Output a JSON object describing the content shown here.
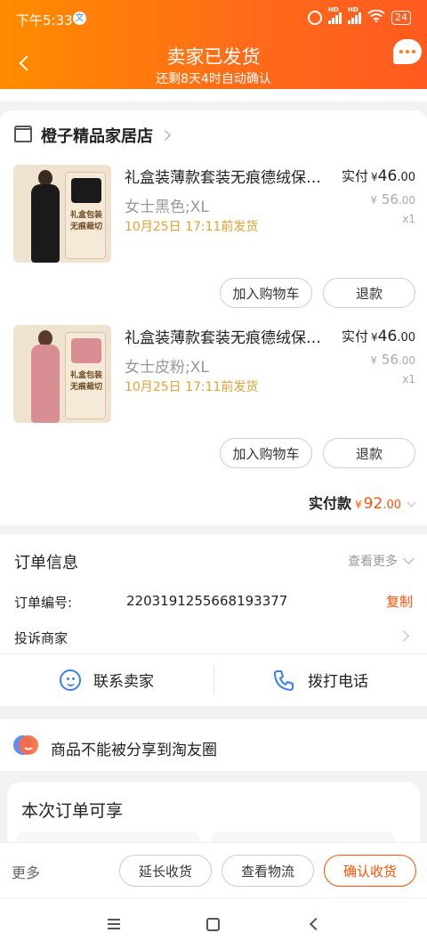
{
  "status_bar": {
    "time": "下午5:33",
    "app_icon": "文",
    "battery": "24",
    "signal1_label": "HD",
    "signal2_label": "HD"
  },
  "header": {
    "title": "卖家已发货",
    "subtitle": "还剩8天4时自动确认",
    "color_start": "#ff8c00",
    "color_end": "#ff5a1f"
  },
  "shop": {
    "name": "橙子精品家居店"
  },
  "items": [
    {
      "title": "礼盒装薄款套装无痕德绒保…",
      "spec": "女士黑色;XL",
      "ship": "10月25日 17:11前发货",
      "paid_label": "实付",
      "paid_currency": "¥",
      "paid_int": "46",
      "paid_dec": ".00",
      "orig_currency": "¥",
      "orig_int": "56",
      "orig_dec": ".00",
      "qty": "x1",
      "btn_add": "加入购物车",
      "btn_refund": "退款",
      "thumb_box_text": "礼盒包装\n无痕裁切",
      "garment_color": "#1a1a1a"
    },
    {
      "title": "礼盒装薄款套装无痕德绒保…",
      "spec": "女士皮粉;XL",
      "ship": "10月25日 17:11前发货",
      "paid_label": "实付",
      "paid_currency": "¥",
      "paid_int": "46",
      "paid_dec": ".00",
      "orig_currency": "¥",
      "orig_int": "56",
      "orig_dec": ".00",
      "qty": "x1",
      "btn_add": "加入购物车",
      "btn_refund": "退款",
      "thumb_box_text": "礼盒包装\n无痕裁切",
      "garment_color": "#d98e94"
    }
  ],
  "total": {
    "label": "实付款",
    "currency": "¥",
    "int": "92",
    "dec": ".00"
  },
  "order_info": {
    "title": "订单信息",
    "more": "查看更多",
    "order_no_label": "订单编号:",
    "order_no": "2203191255668193377",
    "copy": "复制",
    "complain": "投诉商家",
    "contact_seller": "联系卖家",
    "call": "拨打电话"
  },
  "share": {
    "text": "商品不能被分享到淘友圈"
  },
  "enjoy": {
    "title": "本次订单可享"
  },
  "bottom_bar": {
    "more": "更多",
    "extend": "延长收货",
    "logistics": "查看物流",
    "confirm": "确认收货"
  },
  "colors": {
    "accent": "#ff5000",
    "ship_text": "#e8a12f",
    "icon_blue": "#3b7ff0"
  }
}
